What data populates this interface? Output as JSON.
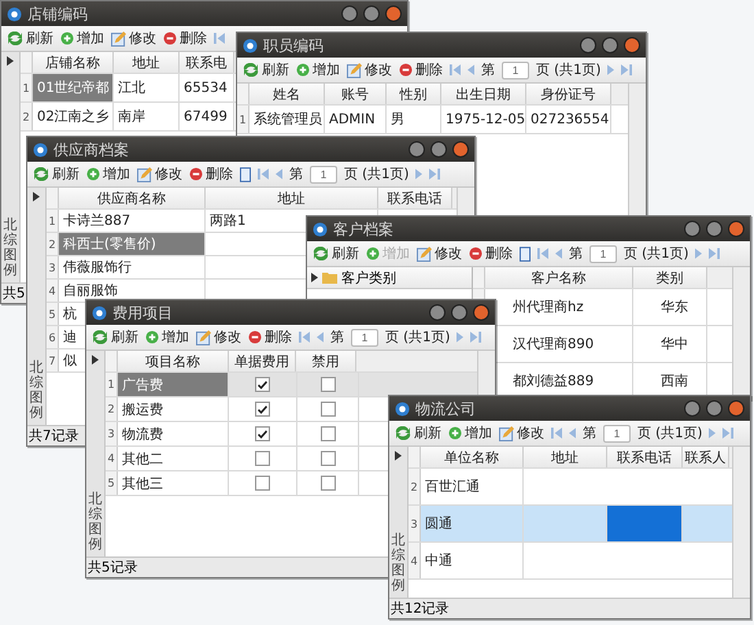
{
  "windows": [
    {
      "title": "店铺编码",
      "side_label": "北综图例",
      "footer": "共5",
      "toolbar": [
        {
          "kind": "refresh",
          "label": "刷新"
        },
        {
          "kind": "add",
          "label": "增加"
        },
        {
          "kind": "edit",
          "label": "修改"
        },
        {
          "kind": "delete",
          "label": "删除"
        },
        {
          "kind": "first"
        }
      ],
      "columns": [
        "店铺名称",
        "地址",
        "联系电"
      ],
      "rows": [
        {
          "num": "1",
          "selected": false,
          "cells": [
            {
              "text": "01世纪帝都",
              "selected": true
            },
            "江北",
            "65534"
          ]
        },
        {
          "num": "2",
          "selected": false,
          "cells": [
            "02江南之乡",
            "南岸",
            "67499"
          ]
        }
      ]
    },
    {
      "title": "职员编码",
      "toolbar": [
        {
          "kind": "refresh",
          "label": "刷新"
        },
        {
          "kind": "add",
          "label": "增加"
        },
        {
          "kind": "edit",
          "label": "修改"
        },
        {
          "kind": "delete",
          "label": "删除"
        },
        {
          "kind": "first"
        },
        {
          "kind": "prev"
        },
        {
          "kind": "pager",
          "prefix": "第",
          "page": "1",
          "suffix": "页 (共1页)"
        },
        {
          "kind": "next"
        },
        {
          "kind": "last"
        }
      ],
      "columns": [
        "姓名",
        "账号",
        "性别",
        "出生日期",
        "身份证号"
      ],
      "rows": [
        {
          "num": "1",
          "selected": false,
          "cells": [
            "系统管理员",
            "ADMIN",
            "男",
            "1975-12-05",
            "027236554"
          ]
        }
      ]
    },
    {
      "title": "供应商档案",
      "side_label": "北综图例",
      "footer": "共7记录",
      "toolbar": [
        {
          "kind": "refresh",
          "label": "刷新"
        },
        {
          "kind": "add",
          "label": "增加"
        },
        {
          "kind": "edit",
          "label": "修改"
        },
        {
          "kind": "delete",
          "label": "删除"
        },
        {
          "kind": "export"
        },
        {
          "kind": "first"
        },
        {
          "kind": "prev"
        },
        {
          "kind": "pager",
          "prefix": "第",
          "page": "1",
          "suffix": "页 (共1页)"
        },
        {
          "kind": "next"
        },
        {
          "kind": "last"
        }
      ],
      "columns": [
        "供应商名称",
        "地址",
        "联系电话"
      ],
      "rows": [
        {
          "num": "1",
          "selected": false,
          "cells": [
            "卡诗兰887",
            "两路1"
          ]
        },
        {
          "num": "2",
          "selected": false,
          "cells": [
            {
              "text": "科西士(零售价)",
              "selected": true
            }
          ]
        },
        {
          "num": "3",
          "selected": false,
          "cells": [
            "伟薇服饰行"
          ]
        },
        {
          "num": "4",
          "selected": false,
          "cells": [
            "自丽服饰"
          ]
        },
        {
          "num": "5",
          "selected": false,
          "cells": [
            "杭"
          ]
        },
        {
          "num": "6",
          "selected": false,
          "cells": [
            "迪"
          ]
        },
        {
          "num": "7",
          "selected": false,
          "cells": [
            "似"
          ]
        }
      ]
    },
    {
      "title": "客户档案",
      "toolbar": [
        {
          "kind": "refresh",
          "label": "刷新"
        },
        {
          "kind": "add",
          "label": "增加",
          "disabled": true
        },
        {
          "kind": "edit",
          "label": "修改"
        },
        {
          "kind": "delete",
          "label": "删除"
        },
        {
          "kind": "export"
        },
        {
          "kind": "first"
        },
        {
          "kind": "prev"
        },
        {
          "kind": "pager",
          "prefix": "第",
          "page": "1",
          "suffix": "页 (共1页)"
        },
        {
          "kind": "next"
        },
        {
          "kind": "last"
        }
      ],
      "tree": {
        "header": "客户类别"
      },
      "columns": [
        "客户名称",
        "类别"
      ],
      "rows": [
        {
          "selected": false,
          "cells": [
            "州代理商hz",
            "华东"
          ]
        },
        {
          "selected": false,
          "cells": [
            "汉代理商890",
            "华中"
          ]
        },
        {
          "selected": false,
          "cells": [
            "都刘德益889",
            "西南"
          ]
        }
      ]
    },
    {
      "title": "费用项目",
      "side_label": "北综图例",
      "footer": "共5记录",
      "toolbar": [
        {
          "kind": "refresh",
          "label": "刷新"
        },
        {
          "kind": "add",
          "label": "增加"
        },
        {
          "kind": "edit",
          "label": "修改"
        },
        {
          "kind": "delete",
          "label": "删除"
        },
        {
          "kind": "first"
        },
        {
          "kind": "prev"
        },
        {
          "kind": "pager",
          "prefix": "第",
          "page": "1",
          "suffix": "页 (共1页)"
        },
        {
          "kind": "next"
        },
        {
          "kind": "last"
        }
      ],
      "columns": [
        "项目名称",
        "单据费用",
        "禁用"
      ],
      "rows": [
        {
          "num": "1",
          "selected": true,
          "cells": [
            {
              "text": "广告费",
              "selected": true
            },
            {
              "kind": "check",
              "checked": true
            },
            {
              "kind": "check",
              "checked": false
            }
          ]
        },
        {
          "num": "2",
          "selected": false,
          "cells": [
            "搬运费",
            {
              "kind": "check",
              "checked": true
            },
            {
              "kind": "check",
              "checked": false
            }
          ]
        },
        {
          "num": "3",
          "selected": false,
          "cells": [
            "物流费",
            {
              "kind": "check",
              "checked": true
            },
            {
              "kind": "check",
              "checked": false
            }
          ]
        },
        {
          "num": "4",
          "selected": false,
          "cells": [
            "其他二",
            {
              "kind": "check",
              "checked": false
            },
            {
              "kind": "check",
              "checked": false
            }
          ]
        },
        {
          "num": "5",
          "selected": false,
          "cells": [
            "其他三",
            {
              "kind": "check",
              "checked": false
            },
            {
              "kind": "check",
              "checked": false
            }
          ]
        }
      ]
    },
    {
      "title": "物流公司",
      "side_label": "北综图例",
      "footer": "共12记录",
      "toolbar": [
        {
          "kind": "refresh",
          "label": "刷新"
        },
        {
          "kind": "add",
          "label": "增加"
        },
        {
          "kind": "edit",
          "label": "修改"
        },
        {
          "kind": "first"
        },
        {
          "kind": "prev"
        },
        {
          "kind": "pager",
          "prefix": "第",
          "page": "1",
          "suffix": "页 (共1页)"
        },
        {
          "kind": "next"
        },
        {
          "kind": "last"
        }
      ],
      "columns": [
        "单位名称",
        "地址",
        "联系电话",
        "联系人"
      ],
      "rows": [
        {
          "num": "2",
          "selected": false,
          "cells": [
            "百世汇通"
          ]
        },
        {
          "num": "3",
          "selected": true,
          "cells": [
            "圆通",
            "",
            {
              "text": "",
              "selected": true
            }
          ]
        },
        {
          "num": "4",
          "selected": false,
          "cells": [
            "中通"
          ]
        }
      ]
    }
  ]
}
